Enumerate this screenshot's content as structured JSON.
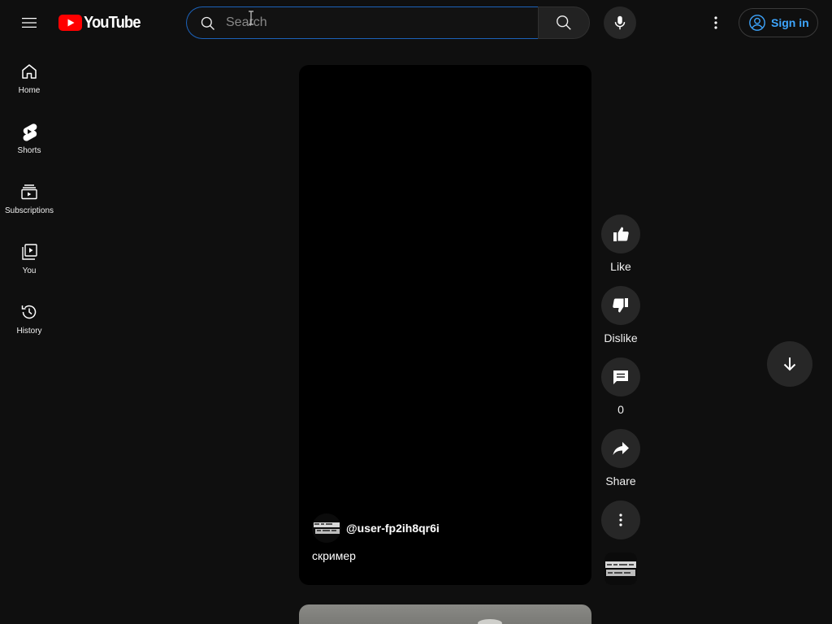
{
  "header": {
    "logo_text": "YouTube",
    "search": {
      "placeholder": "Search",
      "value": ""
    },
    "signin_label": "Sign in"
  },
  "sidebar": {
    "items": [
      {
        "label": "Home",
        "icon": "home-icon"
      },
      {
        "label": "Shorts",
        "icon": "shorts-icon"
      },
      {
        "label": "Subscriptions",
        "icon": "subscriptions-icon"
      },
      {
        "label": "You",
        "icon": "you-icon"
      },
      {
        "label": "History",
        "icon": "history-icon"
      }
    ]
  },
  "short": {
    "channel": "@user-fp2ih8qr6i",
    "title": "скример"
  },
  "actions": {
    "like_label": "Like",
    "dislike_label": "Dislike",
    "comments_count": "0",
    "share_label": "Share"
  },
  "colors": {
    "background": "#0f0f0f",
    "accent_blue": "#3ea6ff",
    "brand_red": "#ff0000",
    "button_bg": "#272727"
  }
}
